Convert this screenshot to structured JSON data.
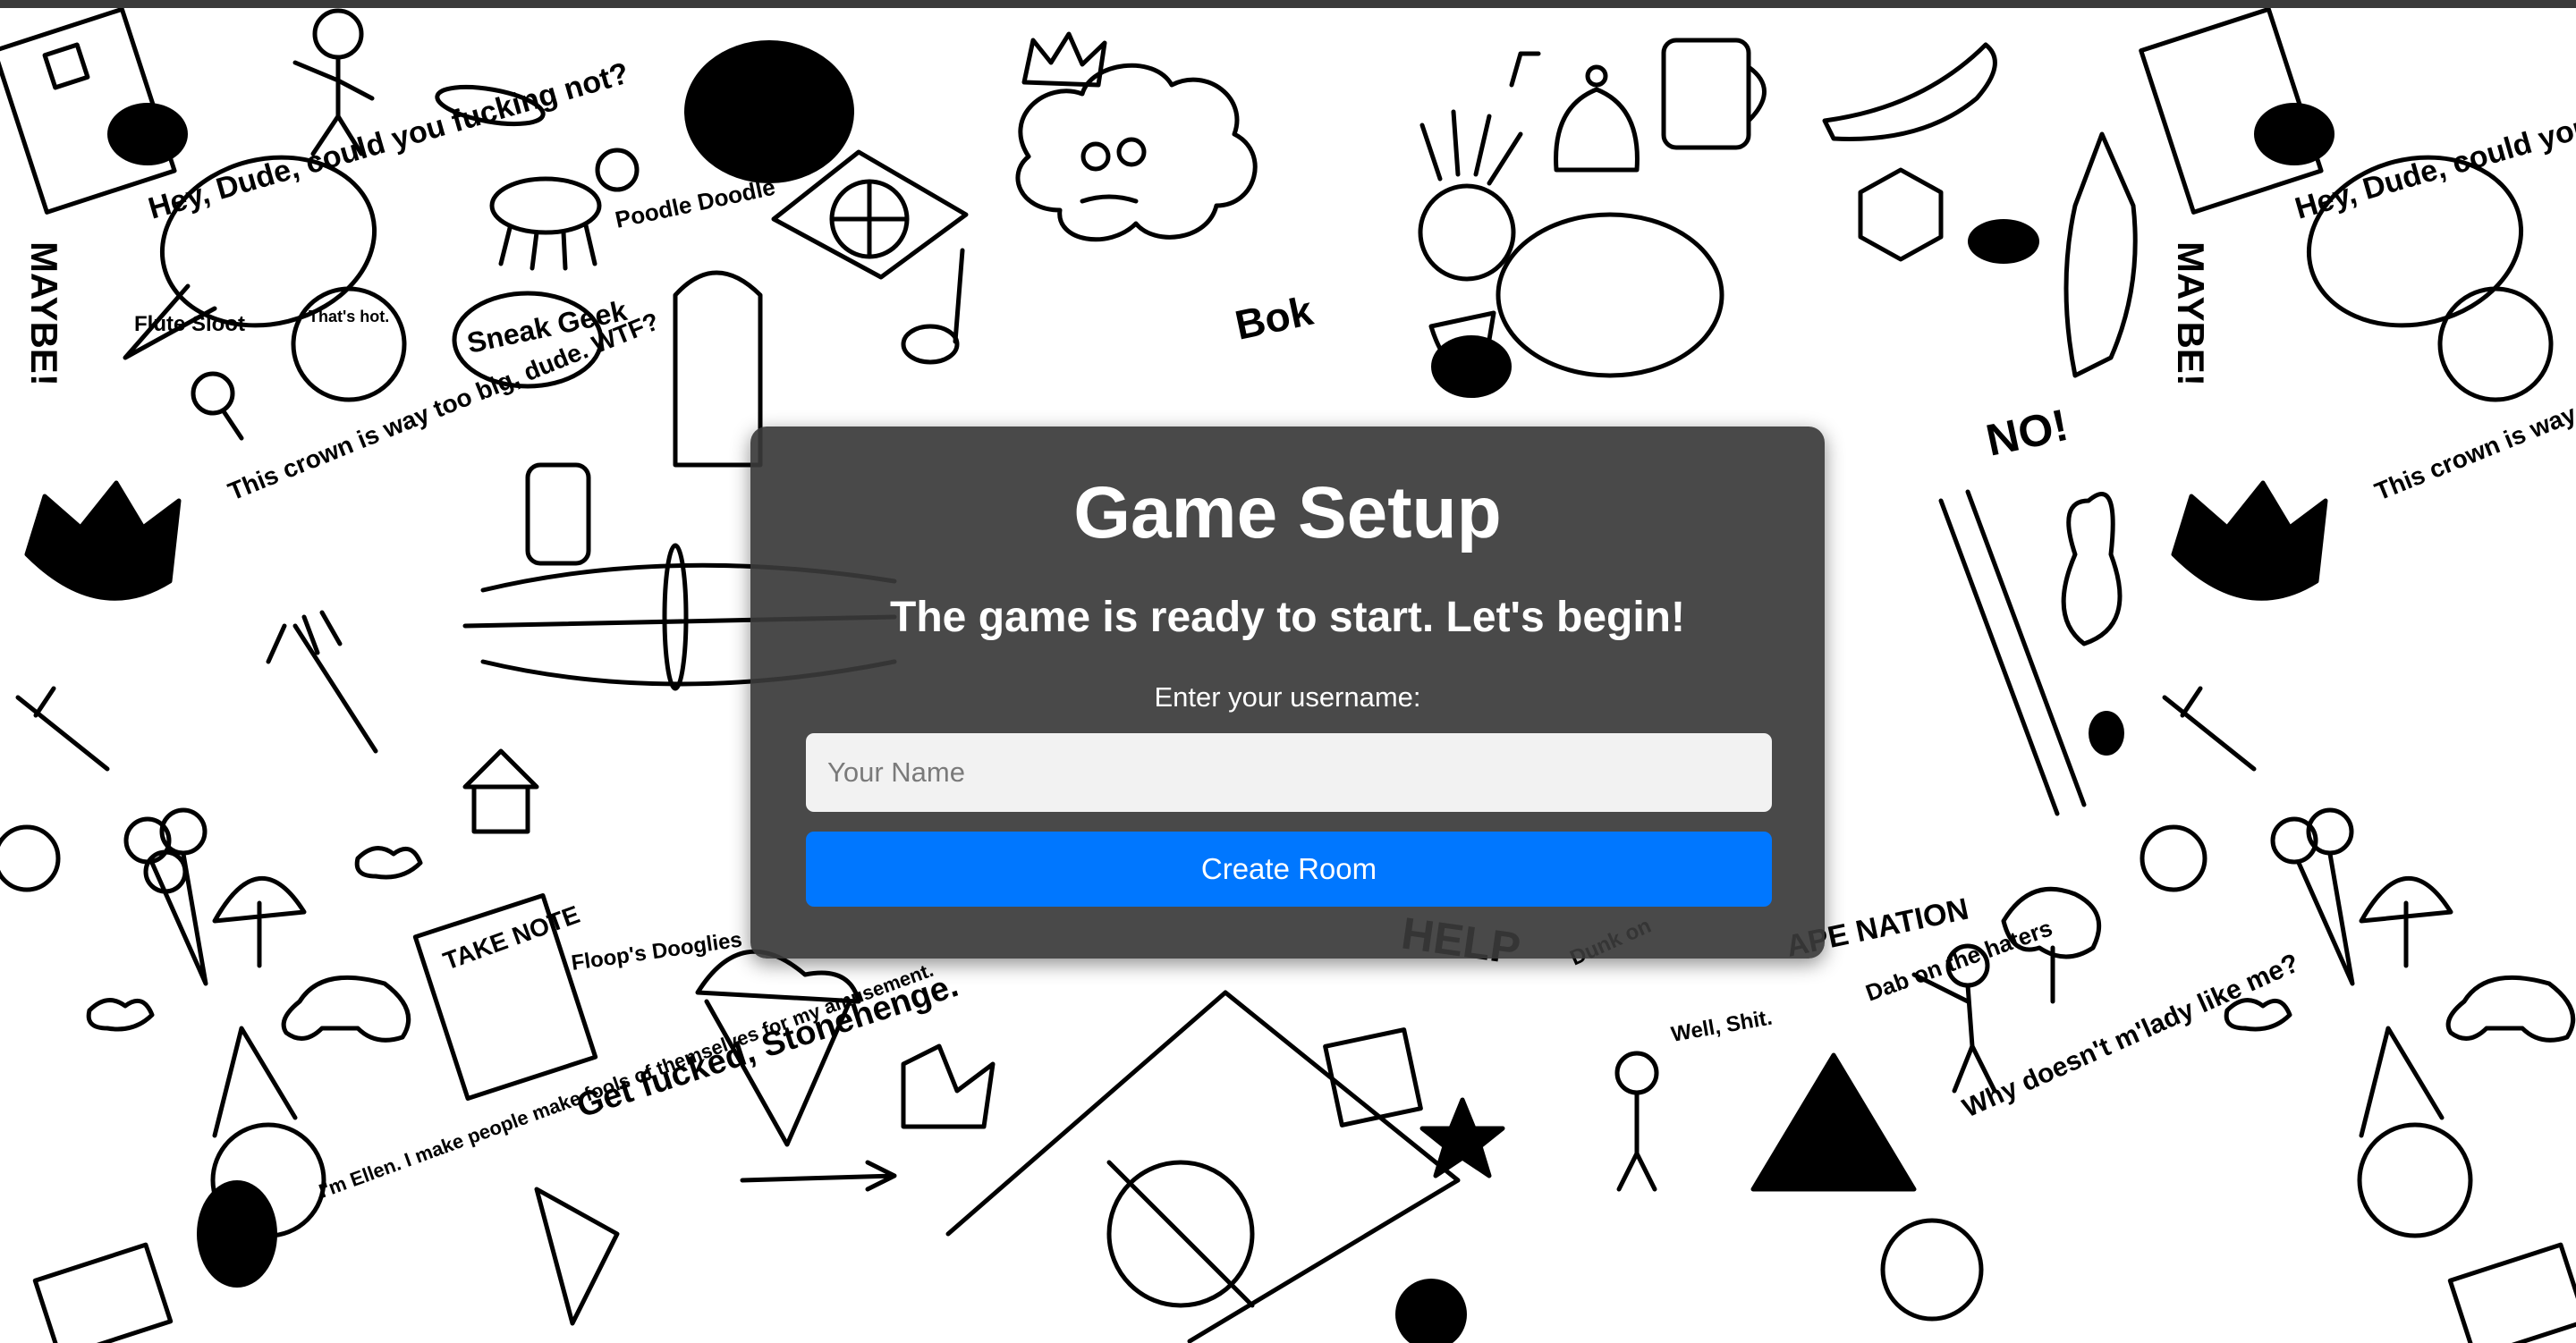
{
  "setup": {
    "title": "Game Setup",
    "subtitle": "The game is ready to start. Let's begin!",
    "username_label": "Enter your username:",
    "username_placeholder": "Your Name",
    "username_value": "",
    "create_button_label": "Create Room"
  },
  "colors": {
    "card_background": "#3a3a3a",
    "button_primary": "#0077ff",
    "input_background": "#f2f2f2",
    "text_primary": "#ffffff",
    "doodle_ink": "#000000",
    "page_background": "#ffffff"
  },
  "background": {
    "doodle_texts": [
      "Hey, Dude, could you fucking not?",
      "That's hot.",
      "MAYBE!",
      "Flute Sloot",
      "Poodle Doodle",
      "Sneak Geek",
      "This crown is way too big, dude. WTF?",
      "Bok",
      "NO!",
      "TAKE NOTE",
      "Floop's Dooglies",
      "Get fucked, Stonehenge.",
      "I'm Ellen. I make people make fools of themselves for my amusement.",
      "HELP",
      "Well, Shit.",
      "Dab on the haters",
      "Why doesn't m'lady like me?",
      "APE NATION",
      "Dunk on"
    ],
    "doodle_icons": [
      "crown-icon",
      "pizza-icon",
      "cloud-face-icon",
      "bell-icon",
      "chicken-icon",
      "pepper-icon",
      "squid-icon",
      "game-controller-icon",
      "ice-cream-icon",
      "tree-icon",
      "balloon-icon",
      "sword-icon",
      "house-icon",
      "star-icon",
      "arrow-icon",
      "tent-icon",
      "ladder-icon"
    ]
  }
}
